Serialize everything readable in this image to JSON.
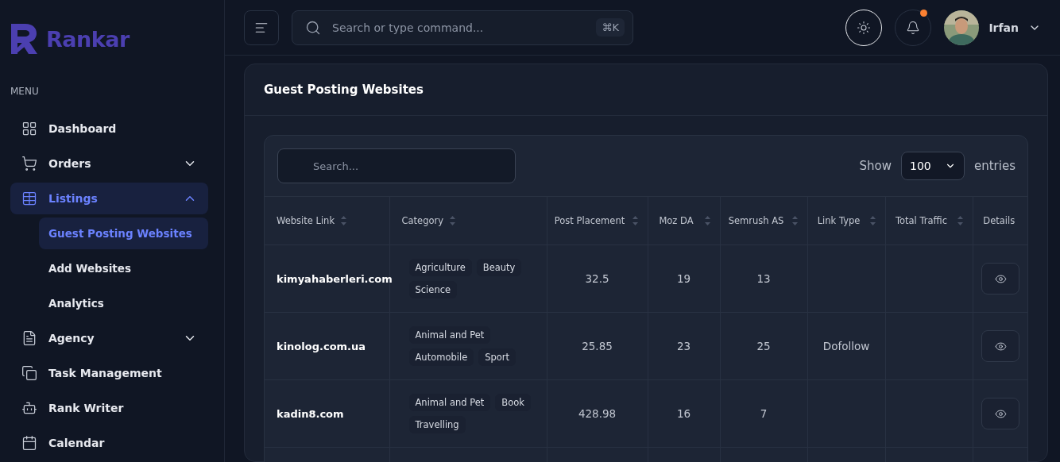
{
  "brand": {
    "name": "Rankar"
  },
  "sidebar": {
    "heading": "MENU",
    "items": [
      {
        "label": "Dashboard",
        "selected": false
      },
      {
        "label": "Orders",
        "selected": false,
        "expanded": false
      },
      {
        "label": "Listings",
        "selected": true,
        "expanded": true,
        "children": [
          {
            "label": "Guest Posting Websites",
            "selected": true
          },
          {
            "label": "Add Websites",
            "selected": false
          },
          {
            "label": "Analytics",
            "selected": false
          }
        ]
      },
      {
        "label": "Agency",
        "selected": false,
        "expanded": false
      },
      {
        "label": "Task Management",
        "selected": false
      },
      {
        "label": "Rank Writer",
        "selected": false
      },
      {
        "label": "Calendar",
        "selected": false
      }
    ]
  },
  "topbar": {
    "search": {
      "placeholder": "Search or type command...",
      "shortcut": "⌘K"
    },
    "notifications": {
      "unread": true
    },
    "user": {
      "name": "Irfan"
    }
  },
  "page": {
    "title": "Guest Posting Websites"
  },
  "table": {
    "search": {
      "placeholder": "Search..."
    },
    "show_label": "Show",
    "page_size": "100",
    "entries_label": "entries",
    "columns": [
      {
        "label": "Website Link",
        "sortable": true
      },
      {
        "label": "Category",
        "sortable": true
      },
      {
        "label": "Post Placement",
        "sortable": true
      },
      {
        "label": "Moz DA",
        "sortable": true
      },
      {
        "label": "Semrush AS",
        "sortable": true
      },
      {
        "label": "Link Type",
        "sortable": true
      },
      {
        "label": "Total Traffic",
        "sortable": true
      },
      {
        "label": "Details",
        "sortable": false
      }
    ],
    "rows": [
      {
        "website": "kimyahaberleri.com",
        "categories": [
          "Agriculture",
          "Beauty",
          "Science"
        ],
        "post_placement": "32.5",
        "moz_da": "19",
        "semrush_as": "13"
      },
      {
        "website": "kinolog.com.ua",
        "categories": [
          "Animal and Pet",
          "Automobile",
          "Sport"
        ],
        "post_placement": "25.85",
        "moz_da": "23",
        "semrush_as": "25",
        "link_type": "Dofollow"
      },
      {
        "website": "kadin8.com",
        "categories": [
          "Animal and Pet",
          "Book",
          "Travelling"
        ],
        "post_placement": "428.98",
        "moz_da": "16",
        "semrush_as": "7"
      }
    ]
  }
}
